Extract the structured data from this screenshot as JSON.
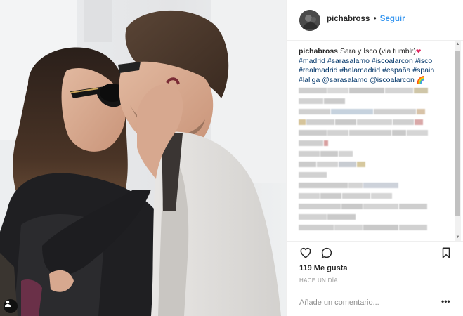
{
  "header": {
    "username": "pichabross",
    "separator": "•",
    "follow_label": "Seguir"
  },
  "caption": {
    "username": "pichabross",
    "text": "Sara y Isco (via tumblr)",
    "heart_emoji": "❤",
    "hashtags_line1": "#madrid #sarasalamo #iscoalarcon #isco",
    "hashtags_line2": "#realmadrid #halamadrid #españa #spain",
    "hashtags_line3": "#laliga @sarasalamo @iscoalarcon",
    "rainbow_emoji": "🌈"
  },
  "scrollbar": {
    "up_arrow": "▲",
    "down_arrow": "▼"
  },
  "actions": {
    "like_icon": "heart-outline-icon",
    "comment_icon": "comment-bubble-icon",
    "save_icon": "bookmark-icon"
  },
  "likes_text": "119 Me gusta",
  "time_text": "HACE UN DÍA",
  "comment": {
    "placeholder": "Añade un comentario...",
    "more_label": "•••"
  },
  "colors": {
    "link_blue": "#3897f0",
    "hashtag_blue": "#003569",
    "border": "#efefef",
    "muted_text": "#999999"
  }
}
